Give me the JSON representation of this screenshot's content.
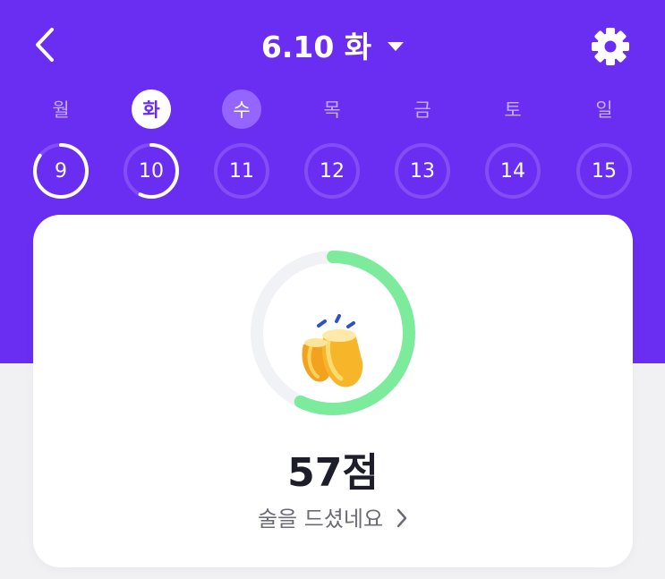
{
  "header": {
    "date_title": "6.10 화"
  },
  "week": [
    {
      "dow": "월",
      "day": "9",
      "state": "past",
      "progress": 0.85
    },
    {
      "dow": "화",
      "day": "10",
      "state": "active",
      "progress": 0.57
    },
    {
      "dow": "수",
      "day": "11",
      "state": "next",
      "progress": 0
    },
    {
      "dow": "목",
      "day": "12",
      "state": "future",
      "progress": 0
    },
    {
      "dow": "금",
      "day": "13",
      "state": "future",
      "progress": 0
    },
    {
      "dow": "토",
      "day": "14",
      "state": "future",
      "progress": 0
    },
    {
      "dow": "일",
      "day": "15",
      "state": "future",
      "progress": 0
    }
  ],
  "score": {
    "value": "57점",
    "progress": 0.57,
    "message": "술을 드셨네요"
  },
  "colors": {
    "brand": "#6A2DF2",
    "ring_progress": "#7CEB9C",
    "ring_track": "#F1F2F6"
  },
  "icons": {
    "back": "chevron-left",
    "dropdown": "caret-down",
    "settings": "gear",
    "score_illustration": "cheers-glass",
    "more": "chevron-right"
  }
}
